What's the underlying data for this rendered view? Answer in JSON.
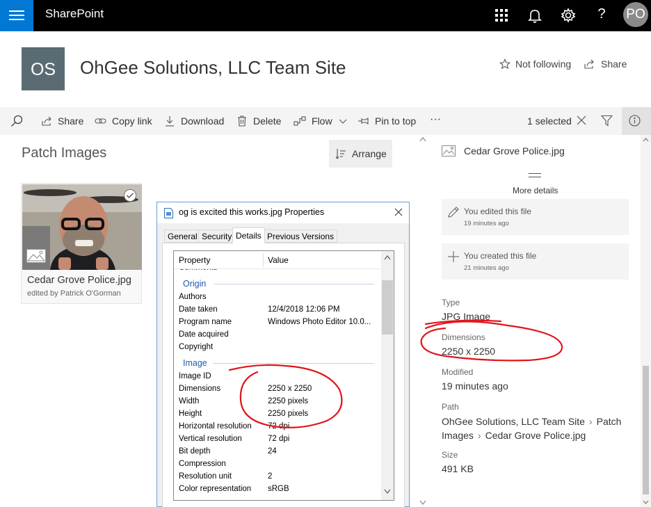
{
  "suite": {
    "app_name": "SharePoint",
    "avatar_initials": "PO",
    "icons": [
      "app-launcher-icon",
      "bell-icon",
      "gear-icon",
      "help-icon"
    ]
  },
  "site": {
    "logo_initials": "OS",
    "title": "OhGee Solutions, LLC Team Site",
    "follow_label": "Not following",
    "share_label": "Share"
  },
  "command_bar": {
    "share": "Share",
    "copy_link": "Copy link",
    "download": "Download",
    "delete": "Delete",
    "flow": "Flow",
    "pin_to_top": "Pin to top",
    "more": "···",
    "selected_count": "1 selected"
  },
  "library": {
    "title": "Patch Images",
    "arrange_label": "Arrange",
    "tile": {
      "name": "Cedar Grove Police.jpg",
      "subtitle": "edited by Patrick O'Gorman"
    }
  },
  "dialog": {
    "title": "og is excited this works.jpg Properties",
    "tabs": [
      "General",
      "Security",
      "Details",
      "Previous Versions"
    ],
    "active_tab": "Details",
    "headers": {
      "property": "Property",
      "value": "Value"
    },
    "partial_row": "Comments",
    "groups": {
      "origin": "Origin",
      "image": "Image"
    },
    "origin_rows": [
      {
        "name": "Authors",
        "value": ""
      },
      {
        "name": "Date taken",
        "value": "12/4/2018 12:06 PM"
      },
      {
        "name": "Program name",
        "value": "Windows Photo Editor 10.0..."
      },
      {
        "name": "Date acquired",
        "value": ""
      },
      {
        "name": "Copyright",
        "value": ""
      }
    ],
    "image_rows": [
      {
        "name": "Image ID",
        "value": ""
      },
      {
        "name": "Dimensions",
        "value": "2250 x 2250"
      },
      {
        "name": "Width",
        "value": "2250 pixels"
      },
      {
        "name": "Height",
        "value": "2250 pixels"
      },
      {
        "name": "Horizontal resolution",
        "value": "72 dpi"
      },
      {
        "name": "Vertical resolution",
        "value": "72 dpi"
      },
      {
        "name": "Bit depth",
        "value": "24"
      },
      {
        "name": "Compression",
        "value": ""
      },
      {
        "name": "Resolution unit",
        "value": "2"
      },
      {
        "name": "Color representation",
        "value": "sRGB"
      }
    ]
  },
  "details_pane": {
    "file_name": "Cedar Grove Police.jpg",
    "more_details": "More details",
    "activities": [
      {
        "title": "You edited this file",
        "time": "19 minutes ago"
      },
      {
        "title": "You created this file",
        "time": "21 minutes ago"
      }
    ],
    "properties": {
      "type_label": "Type",
      "type_value": "JPG Image",
      "dimensions_label": "Dimensions",
      "dimensions_value": "2250 x 2250",
      "modified_label": "Modified",
      "modified_value": "19 minutes ago",
      "path_label": "Path",
      "path_site": "OhGee Solutions, LLC Team Site",
      "path_library": "Patch Images",
      "path_file": "Cedar Grove Police.jpg",
      "size_label": "Size",
      "size_value": "491 KB"
    }
  },
  "colors": {
    "suite_bar": "#000000",
    "app_launcher": "#0078d4",
    "site_logo": "#5a6b74",
    "command_bar": "#f4f4f4",
    "annotation": "#e0151a",
    "dialog_group": "#1e5aa8"
  }
}
